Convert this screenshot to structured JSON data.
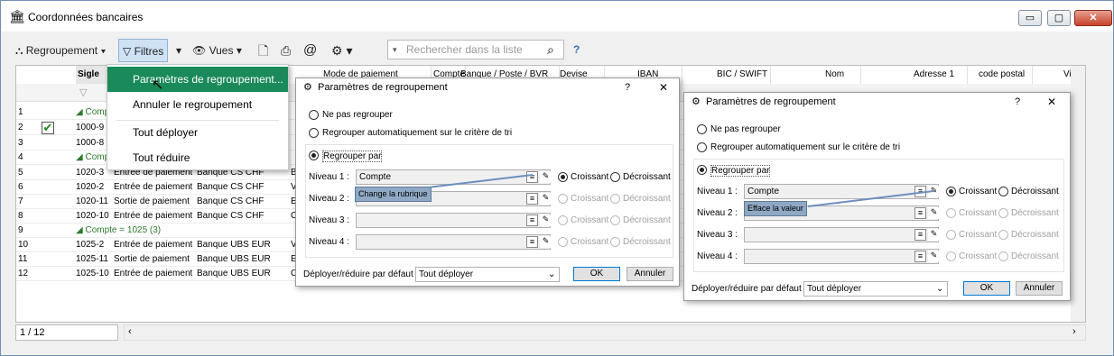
{
  "window": {
    "title": "Coordonnées bancaires",
    "min": "▭",
    "max": "▢",
    "close": "✕"
  },
  "toolbar": {
    "group": "Regroupement",
    "filter": "Filtres",
    "views": "Vues",
    "search_placeholder": "Rechercher dans la liste",
    "help": "?"
  },
  "columns": [
    "Sigle",
    "Mode de paiement",
    "Compte",
    "Banque / Poste / BVR",
    "Devise",
    "IBAN",
    "BIC / SWIFT",
    "Nom",
    "Adresse 1",
    "code postal",
    "Ville"
  ],
  "rows": [
    {
      "n": "1",
      "c1": "Compte ...",
      "grp": true
    },
    {
      "n": "2",
      "c1": "1000-9",
      "check": true
    },
    {
      "n": "3",
      "c1": "1000-8"
    },
    {
      "n": "4",
      "c1": "Compte ...",
      "grp": true
    },
    {
      "n": "5",
      "c1": "1020-3",
      "c2": "Entrée de paiement",
      "c3": "Banque CS CHF",
      "c4": "B"
    },
    {
      "n": "6",
      "c1": "1020-2",
      "c2": "Entrée de paiement",
      "c3": "Banque CS CHF",
      "c4": "V"
    },
    {
      "n": "7",
      "c1": "1020-11",
      "c2": "Sortie de paiement",
      "c3": "Banque CS CHF",
      "c4": "E"
    },
    {
      "n": "8",
      "c1": "1020-10",
      "c2": "Entrée de paiement",
      "c3": "Banque CS CHF",
      "c4": "C"
    },
    {
      "n": "9",
      "c1": "Compte = 1025 (3)",
      "grp": true
    },
    {
      "n": "10",
      "c1": "1025-2",
      "c2": "Entrée de paiement",
      "c3": "Banque UBS EUR",
      "c4": "V"
    },
    {
      "n": "11",
      "c1": "1025-11",
      "c2": "Sortie de paiement",
      "c3": "Banque UBS EUR",
      "c4": "E"
    },
    {
      "n": "12",
      "c1": "1025-10",
      "c2": "Entrée de paiement",
      "c3": "Banque UBS EUR",
      "c4": "C"
    }
  ],
  "menu": [
    "Paramètres de regroupement...",
    "Annuler le regroupement",
    "Tout déployer",
    "Tout réduire"
  ],
  "pager": "1 / 12",
  "dialog": {
    "title": "Paramètres de regroupement",
    "help": "?",
    "close": "✕",
    "opt_none": "Ne pas regrouper",
    "opt_auto": "Regrouper automatiquement sur le critère de tri",
    "opt_by": "Regrouper par",
    "levels": [
      "Niveau 1 :",
      "Niveau 2 :",
      "Niveau 3 :",
      "Niveau 4 :"
    ],
    "level1_value": "Compte",
    "asc": "Croissant",
    "desc": "Décroissant",
    "deploy_label": "Déployer/réduire par défaut :",
    "deploy_value": "Tout déployer",
    "ok": "OK",
    "cancel": "Annuler"
  },
  "tips": {
    "left": "Change la rubrique",
    "right": "Efface la valeur"
  }
}
